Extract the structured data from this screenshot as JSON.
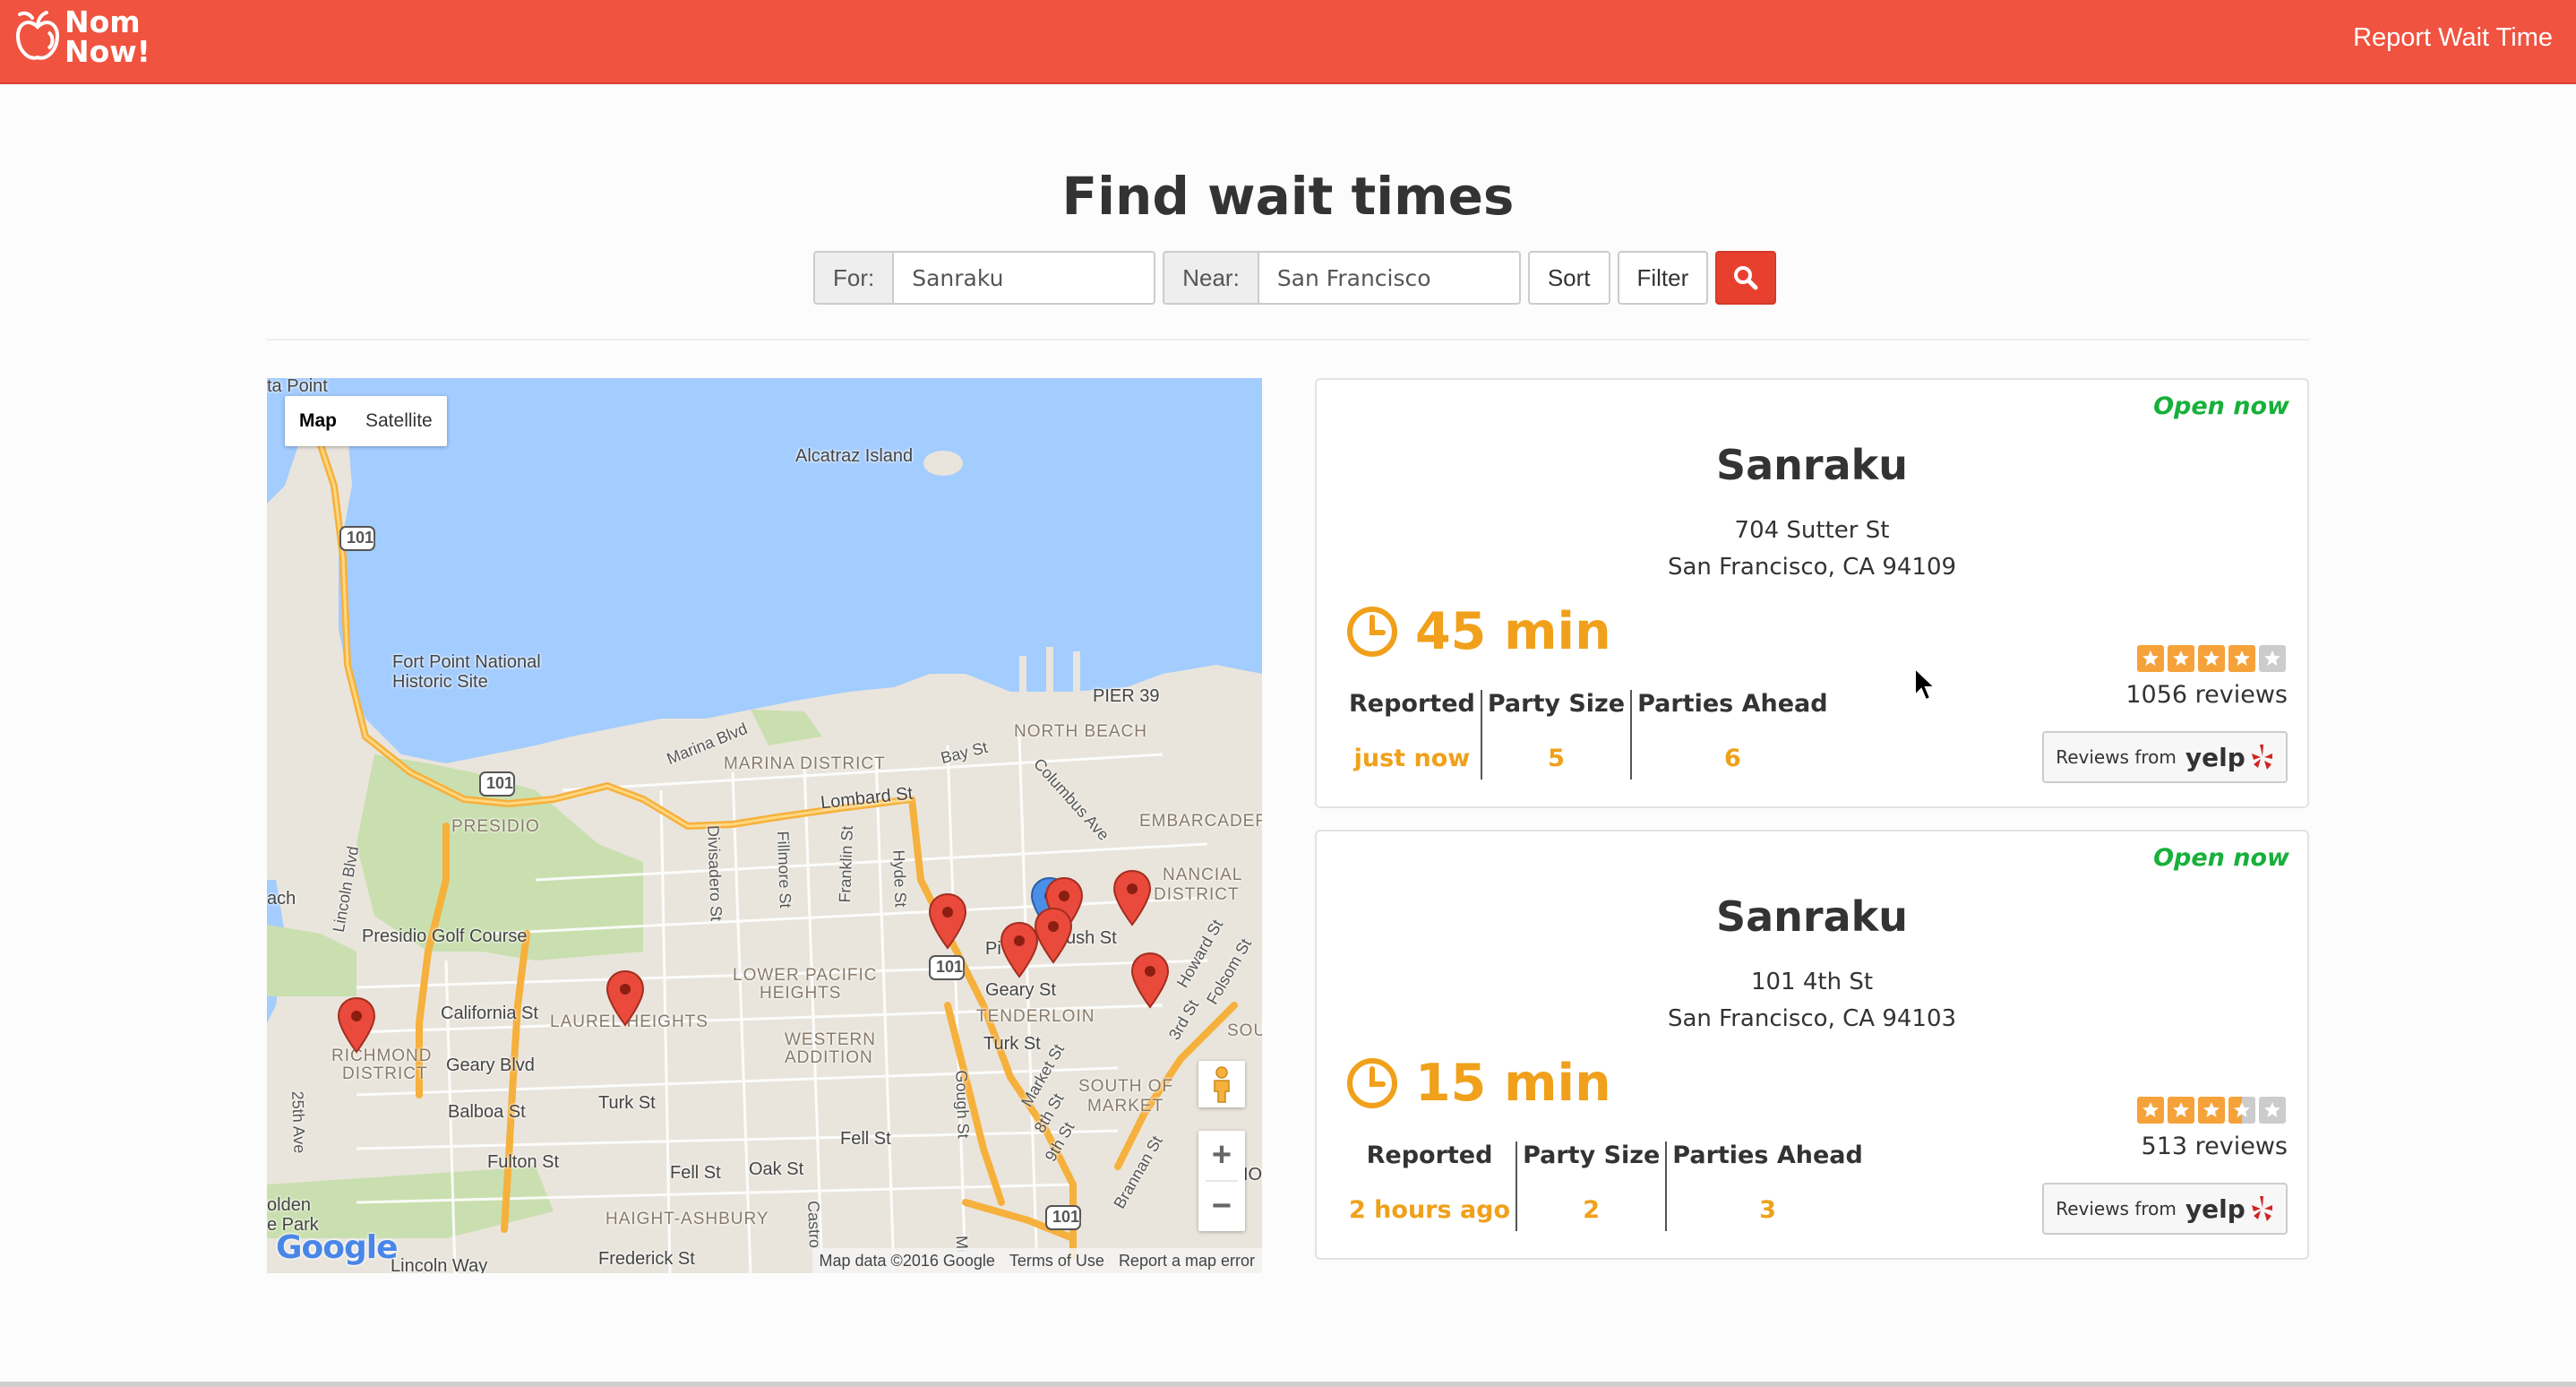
{
  "header": {
    "brand_line1": "Nom",
    "brand_line2": "Now!",
    "report_link": "Report Wait Time"
  },
  "search": {
    "title": "Find wait times",
    "for_label": "For:",
    "for_value": "Sanraku",
    "near_label": "Near:",
    "near_value": "San Francisco",
    "sort_label": "Sort",
    "filter_label": "Filter",
    "search_icon": "search-icon"
  },
  "map": {
    "type_map": "Map",
    "type_satellite": "Satellite",
    "labels": {
      "alcatraz": "Alcatraz Island",
      "fort_point": "Fort Point National",
      "historic_site": "Historic Site",
      "pier39": "PIER 39",
      "north_beach": "NORTH BEACH",
      "marina_district": "MARINA DISTRICT",
      "marina_blvd": "Marina Blvd",
      "bay_st": "Bay St",
      "lombard": "Lombard St",
      "presidio": "PRESIDIO",
      "embarcadero": "EMBARCADERO",
      "financial": "NANCIAL",
      "district": "DISTRICT",
      "columbus": "Columbus Ave",
      "presidio_golf": "Presidio Golf Course",
      "california": "California St",
      "laurel": "LAUREL HEIGHTS",
      "lower_pac": "LOWER PACIFIC",
      "heights": "HEIGHTS",
      "western": "WESTERN",
      "addition": "ADDITION",
      "tenderloin": "TENDERLOIN",
      "richmond": "RICHMOND",
      "richmond_d": "DISTRICT",
      "geary_blvd": "Geary Blvd",
      "geary_st": "Geary St",
      "turk_st": "Turk St",
      "turk_st2": "Turk St",
      "balboa": "Balboa St",
      "fulton": "Fulton St",
      "fell1": "Fell St",
      "fell2": "Fell St",
      "oak": "Oak St",
      "haight": "HAIGHT-ASHBURY",
      "frederick": "Frederick St",
      "lincoln_way": "Lincoln Way",
      "golden": "olden",
      "gate_park": "e Park",
      "south_of": "SOUTH OF",
      "market": "MARKET",
      "market_st": "Market St",
      "bush": "ush St",
      "point": "ta Point",
      "ch": "ach",
      "hwy101a": "101",
      "hwy101b": "101",
      "hwy101c": "101",
      "hwy101d": "101",
      "lincoln_blvd": "Lincoln Blvd",
      "divisadero": "Divisadero St",
      "fillmore": "Fillmore St",
      "franklin": "Franklin St",
      "hyde": "Hyde St",
      "gough": "Gough St",
      "ave25": "25th Ave",
      "howard": "Howard St",
      "folsom": "Folsom St",
      "third": "3rd St",
      "eighth": "8th St",
      "ninth": "9th St",
      "brannan": "Brannan St",
      "castro": "Castro",
      "sou": "SOU",
      "pi": "Pi",
      "mi": "Mi",
      "io": "IO"
    },
    "google": "Google",
    "footer_data": "Map data ©2016 Google",
    "footer_terms": "Terms of Use",
    "footer_report": "Report a map error",
    "zoom_in": "+",
    "zoom_out": "−"
  },
  "results": [
    {
      "status": "Open now",
      "name": "Sanraku",
      "address_line1": "704 Sutter St",
      "address_line2": "San Francisco, CA 94109",
      "wait": "45 min",
      "reported_label": "Reported",
      "party_label": "Party Size",
      "ahead_label": "Parties Ahead",
      "reported_value": "just now",
      "party_value": "5",
      "ahead_value": "6",
      "rating": 4,
      "reviews": "1056 reviews",
      "yelp_from": "Reviews from",
      "yelp_word": "yelp"
    },
    {
      "status": "Open now",
      "name": "Sanraku",
      "address_line1": "101 4th St",
      "address_line2": "San Francisco, CA 94103",
      "wait": "15 min",
      "reported_label": "Reported",
      "party_label": "Party Size",
      "ahead_label": "Parties Ahead",
      "reported_value": "2 hours ago",
      "party_value": "2",
      "ahead_value": "3",
      "rating": 3.5,
      "reviews": "513 reviews",
      "yelp_from": "Reviews from",
      "yelp_word": "yelp"
    }
  ],
  "colors": {
    "brand": "#f05340",
    "wait": "#f0a01a",
    "open": "#17b03a",
    "search_button": "#e8402f"
  }
}
